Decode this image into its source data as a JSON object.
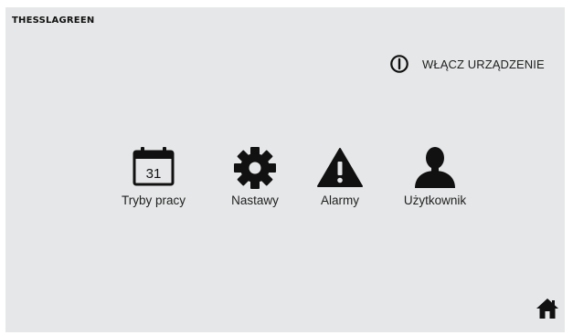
{
  "header": {
    "brand": "THESSLAGREEN"
  },
  "power": {
    "label": "WŁĄCZ URZĄDZENIE",
    "icon": "power-icon"
  },
  "menu": {
    "items": [
      {
        "label": "Tryby pracy",
        "icon": "calendar-icon",
        "day": "31"
      },
      {
        "label": "Nastawy",
        "icon": "gear-icon"
      },
      {
        "label": "Alarmy",
        "icon": "warning-icon"
      },
      {
        "label": "Użytkownik",
        "icon": "user-icon"
      }
    ]
  },
  "footer": {
    "home_icon": "home-icon"
  },
  "colors": {
    "background": "#e6e7e8",
    "icon": "#111111",
    "text": "#1f1f1f"
  }
}
